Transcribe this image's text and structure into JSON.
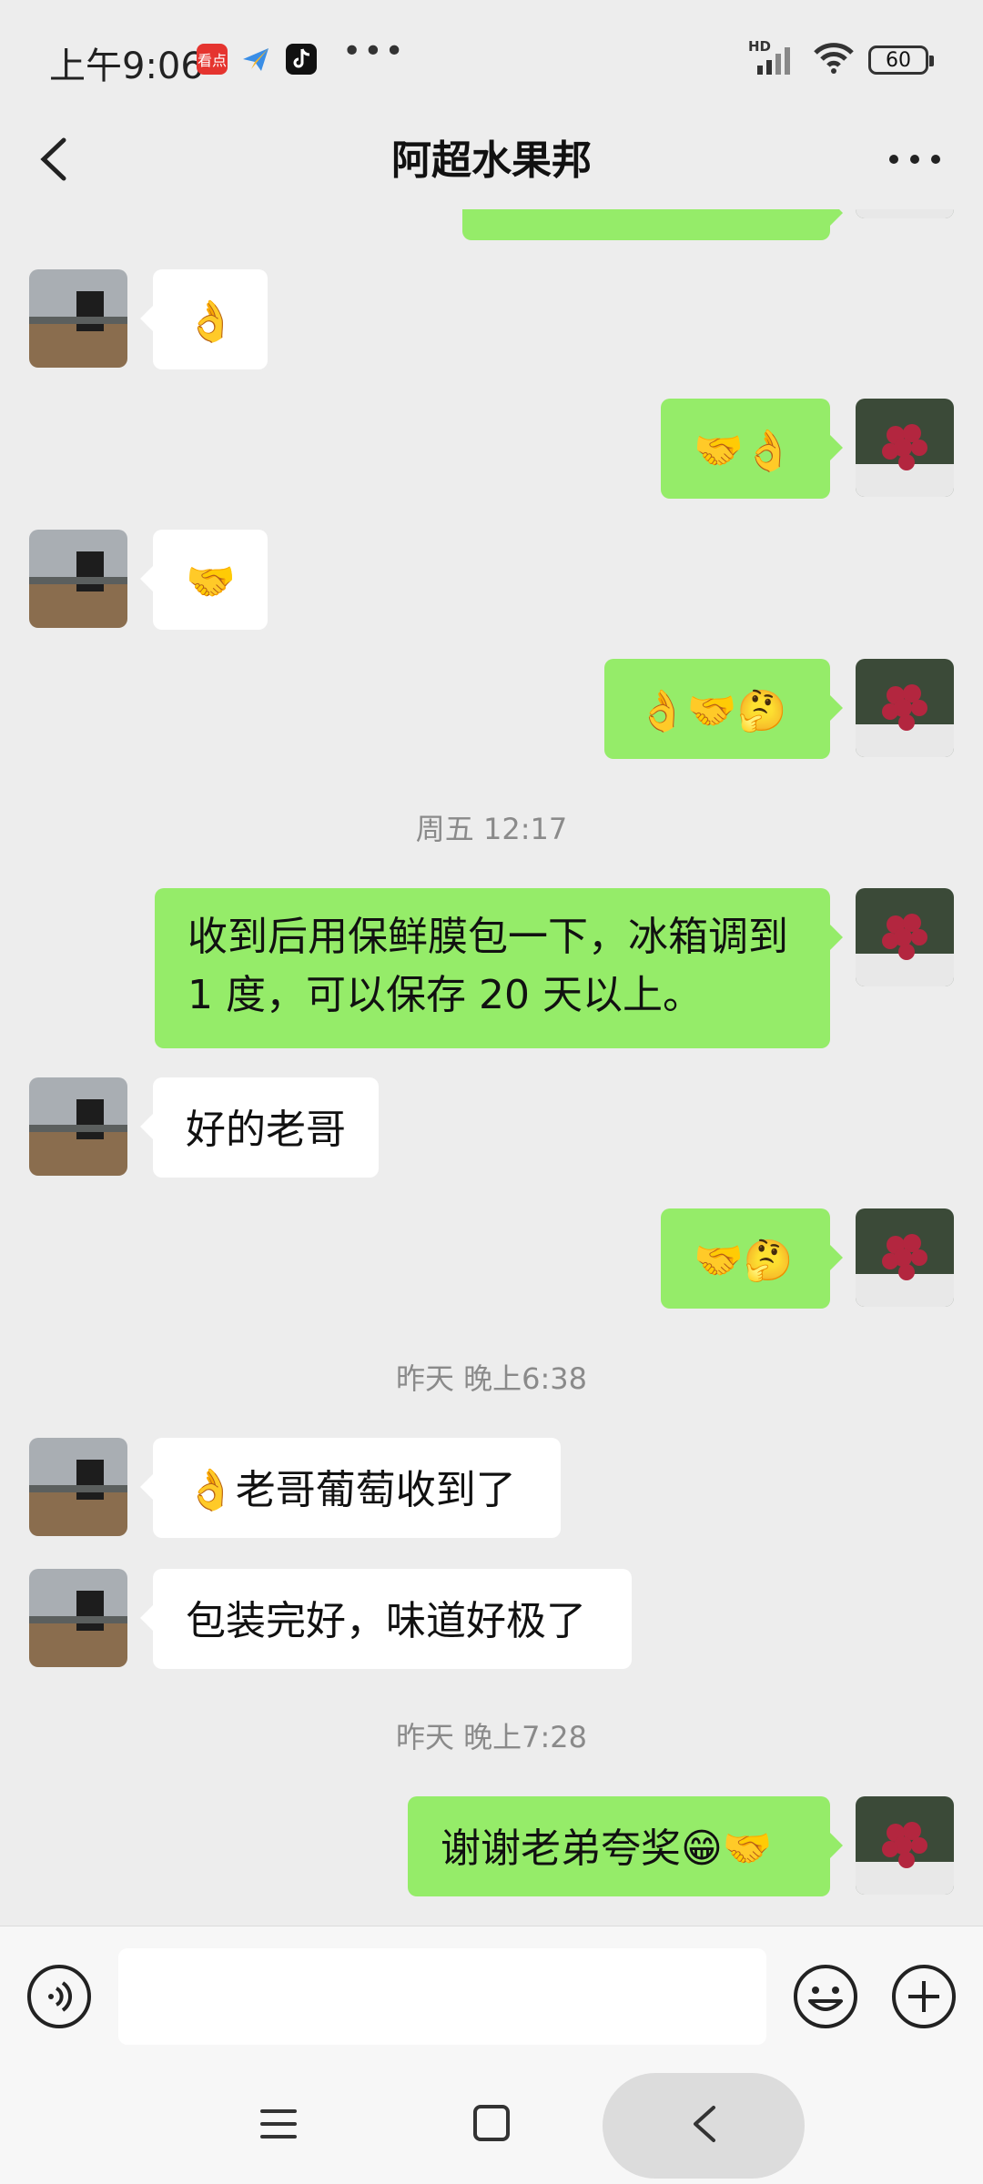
{
  "status_bar": {
    "time": "上午9:06",
    "app_icon_1_text": "看点",
    "network_label": "HD",
    "battery": "60"
  },
  "header": {
    "title": "阿超水果邦"
  },
  "messages": {
    "m1": "👌",
    "m2": "🤝👌",
    "m3": "🤝",
    "m4": "👌🤝🤔",
    "t1": "周五 12:17",
    "m5": "收到后用保鲜膜包一下，冰箱调到 1 度，可以保存 20 天以上。",
    "m6": "好的老哥",
    "m7": "🤝🤔",
    "t2": "昨天 晚上6:38",
    "m8": "👌老哥葡萄收到了",
    "m9": "包装完好，味道好极了",
    "t3": "昨天 晚上7:28",
    "m10": "谢谢老弟夸奖😁🤝"
  },
  "input": {
    "value": "",
    "placeholder": ""
  },
  "colors": {
    "background": "#ededed",
    "outgoing_bubble": "#95ec69",
    "incoming_bubble": "#ffffff",
    "timestamp": "#8a8a8a"
  },
  "icons": {
    "back": "chevron-left-icon",
    "more": "more-horizontal-icon",
    "voice": "voice-icon",
    "emoji": "emoji-icon",
    "plus": "plus-icon",
    "nav_menu": "menu-icon",
    "nav_home": "home-icon",
    "nav_back": "back-icon"
  }
}
